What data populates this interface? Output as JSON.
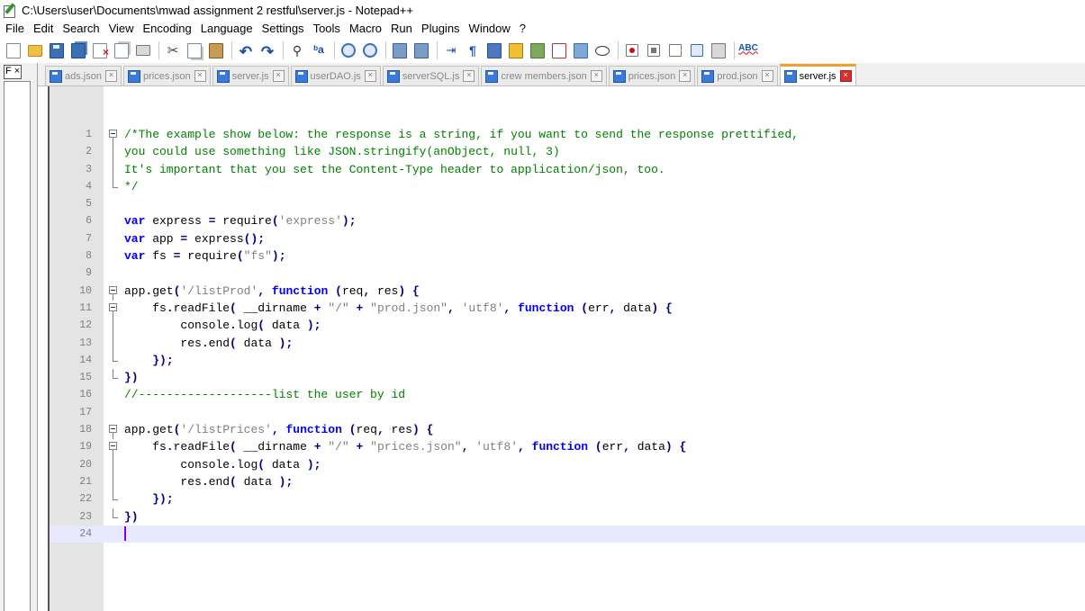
{
  "window": {
    "title": "C:\\Users\\user\\Documents\\mwad assignment 2 restful\\server.js - Notepad++"
  },
  "menu": [
    "File",
    "Edit",
    "Search",
    "View",
    "Encoding",
    "Language",
    "Settings",
    "Tools",
    "Macro",
    "Run",
    "Plugins",
    "Window",
    "?"
  ],
  "toolbar": {
    "groups": [
      [
        "new-file-icon",
        "open-file-icon",
        "save-icon",
        "save-all-icon",
        "close-icon",
        "close-all-icon",
        "print-icon"
      ],
      [
        "cut-icon",
        "copy-icon",
        "paste-icon"
      ],
      [
        "undo-icon",
        "redo-icon"
      ],
      [
        "find-icon",
        "replace-icon"
      ],
      [
        "zoom-in-icon",
        "zoom-out-icon"
      ],
      [
        "sync-vertical-icon",
        "sync-horizontal-icon"
      ],
      [
        "word-wrap-icon",
        "show-all-characters-icon",
        "indent-guide-icon",
        "user-defined-language-icon",
        "document-map-icon",
        "function-list-icon",
        "folder-as-workspace-icon",
        "monitoring-icon"
      ],
      [
        "record-macro-icon",
        "stop-recording-icon",
        "playback-icon",
        "run-macro-multiple-icon",
        "save-macro-icon"
      ],
      [
        "spell-check-icon"
      ]
    ],
    "spell_check_label": "ABC"
  },
  "fpanel": {
    "button_label": "F ×"
  },
  "tabs": [
    {
      "label": "ads.json",
      "active": false
    },
    {
      "label": "prices.json",
      "active": false
    },
    {
      "label": "server.js",
      "active": false
    },
    {
      "label": "userDAO.js",
      "active": false
    },
    {
      "label": "serverSQL.js",
      "active": false
    },
    {
      "label": "crew members.json",
      "active": false
    },
    {
      "label": "prices.json",
      "active": false
    },
    {
      "label": "prod.json",
      "active": false
    },
    {
      "label": "server.js",
      "active": true
    }
  ],
  "tab_close_glyph": "×",
  "editor": {
    "current_line": 24,
    "lines": [
      {
        "n": "1",
        "segs": [
          [
            "cmt",
            "/*The example show below: the response is a string, if you want to send the response prettified,"
          ]
        ]
      },
      {
        "n": "2",
        "segs": [
          [
            "cmt",
            "you could use something like JSON.stringify(anObject, null, 3)"
          ]
        ]
      },
      {
        "n": "3",
        "segs": [
          [
            "cmt",
            "It's important that you set the Content-Type header to application/json, too."
          ]
        ]
      },
      {
        "n": "4",
        "segs": [
          [
            "cmt",
            "*/"
          ]
        ]
      },
      {
        "n": "5",
        "segs": []
      },
      {
        "n": "6",
        "segs": [
          [
            "kw",
            "var"
          ],
          [
            "id",
            " express "
          ],
          [
            "op",
            "="
          ],
          [
            "id",
            " require"
          ],
          [
            "op",
            "("
          ],
          [
            "str",
            "'express'"
          ],
          [
            "op",
            ");"
          ]
        ]
      },
      {
        "n": "7",
        "segs": [
          [
            "kw",
            "var"
          ],
          [
            "id",
            " app "
          ],
          [
            "op",
            "="
          ],
          [
            "id",
            " express"
          ],
          [
            "op",
            "();"
          ]
        ]
      },
      {
        "n": "8",
        "segs": [
          [
            "kw",
            "var"
          ],
          [
            "id",
            " fs "
          ],
          [
            "op",
            "="
          ],
          [
            "id",
            " require"
          ],
          [
            "op",
            "("
          ],
          [
            "str",
            "\"fs\""
          ],
          [
            "op",
            ");"
          ]
        ]
      },
      {
        "n": "9",
        "segs": []
      },
      {
        "n": "10",
        "segs": [
          [
            "id",
            "app"
          ],
          [
            "op",
            "."
          ],
          [
            "id",
            "get"
          ],
          [
            "op",
            "("
          ],
          [
            "str",
            "'/listProd'"
          ],
          [
            "op",
            ","
          ],
          [
            "id",
            " "
          ],
          [
            "kw",
            "function"
          ],
          [
            "id",
            " "
          ],
          [
            "op",
            "("
          ],
          [
            "id",
            "req"
          ],
          [
            "op",
            ","
          ],
          [
            "id",
            " res"
          ],
          [
            "op",
            ")"
          ],
          [
            "id",
            " "
          ],
          [
            "op",
            "{"
          ]
        ]
      },
      {
        "n": "11",
        "segs": [
          [
            "id",
            "    fs"
          ],
          [
            "op",
            "."
          ],
          [
            "id",
            "readFile"
          ],
          [
            "op",
            "("
          ],
          [
            "id",
            " __dirname "
          ],
          [
            "op",
            "+"
          ],
          [
            "id",
            " "
          ],
          [
            "str",
            "\"/\""
          ],
          [
            "id",
            " "
          ],
          [
            "op",
            "+"
          ],
          [
            "id",
            " "
          ],
          [
            "str",
            "\"prod.json\""
          ],
          [
            "op",
            ","
          ],
          [
            "id",
            " "
          ],
          [
            "str",
            "'utf8'"
          ],
          [
            "op",
            ","
          ],
          [
            "id",
            " "
          ],
          [
            "kw",
            "function"
          ],
          [
            "id",
            " "
          ],
          [
            "op",
            "("
          ],
          [
            "id",
            "err"
          ],
          [
            "op",
            ","
          ],
          [
            "id",
            " data"
          ],
          [
            "op",
            ")"
          ],
          [
            "id",
            " "
          ],
          [
            "op",
            "{"
          ]
        ]
      },
      {
        "n": "12",
        "segs": [
          [
            "id",
            "        console"
          ],
          [
            "op",
            "."
          ],
          [
            "id",
            "log"
          ],
          [
            "op",
            "("
          ],
          [
            "id",
            " data "
          ],
          [
            "op",
            ");"
          ]
        ]
      },
      {
        "n": "13",
        "segs": [
          [
            "id",
            "        res"
          ],
          [
            "op",
            "."
          ],
          [
            "id",
            "end"
          ],
          [
            "op",
            "("
          ],
          [
            "id",
            " data "
          ],
          [
            "op",
            ");"
          ]
        ]
      },
      {
        "n": "14",
        "segs": [
          [
            "id",
            "    "
          ],
          [
            "op",
            "});"
          ]
        ]
      },
      {
        "n": "15",
        "segs": [
          [
            "op",
            "})"
          ]
        ]
      },
      {
        "n": "16",
        "segs": [
          [
            "cmt",
            "//-------------------list the user by id"
          ]
        ]
      },
      {
        "n": "17",
        "segs": []
      },
      {
        "n": "18",
        "segs": [
          [
            "id",
            "app"
          ],
          [
            "op",
            "."
          ],
          [
            "id",
            "get"
          ],
          [
            "op",
            "("
          ],
          [
            "str",
            "'/listPrices'"
          ],
          [
            "op",
            ","
          ],
          [
            "id",
            " "
          ],
          [
            "kw",
            "function"
          ],
          [
            "id",
            " "
          ],
          [
            "op",
            "("
          ],
          [
            "id",
            "req"
          ],
          [
            "op",
            ","
          ],
          [
            "id",
            " res"
          ],
          [
            "op",
            ")"
          ],
          [
            "id",
            " "
          ],
          [
            "op",
            "{"
          ]
        ]
      },
      {
        "n": "19",
        "segs": [
          [
            "id",
            "    fs"
          ],
          [
            "op",
            "."
          ],
          [
            "id",
            "readFile"
          ],
          [
            "op",
            "("
          ],
          [
            "id",
            " __dirname "
          ],
          [
            "op",
            "+"
          ],
          [
            "id",
            " "
          ],
          [
            "str",
            "\"/\""
          ],
          [
            "id",
            " "
          ],
          [
            "op",
            "+"
          ],
          [
            "id",
            " "
          ],
          [
            "str",
            "\"prices.json\""
          ],
          [
            "op",
            ","
          ],
          [
            "id",
            " "
          ],
          [
            "str",
            "'utf8'"
          ],
          [
            "op",
            ","
          ],
          [
            "id",
            " "
          ],
          [
            "kw",
            "function"
          ],
          [
            "id",
            " "
          ],
          [
            "op",
            "("
          ],
          [
            "id",
            "err"
          ],
          [
            "op",
            ","
          ],
          [
            "id",
            " data"
          ],
          [
            "op",
            ")"
          ],
          [
            "id",
            " "
          ],
          [
            "op",
            "{"
          ]
        ]
      },
      {
        "n": "20",
        "segs": [
          [
            "id",
            "        console"
          ],
          [
            "op",
            "."
          ],
          [
            "id",
            "log"
          ],
          [
            "op",
            "("
          ],
          [
            "id",
            " data "
          ],
          [
            "op",
            ");"
          ]
        ]
      },
      {
        "n": "21",
        "segs": [
          [
            "id",
            "        res"
          ],
          [
            "op",
            "."
          ],
          [
            "id",
            "end"
          ],
          [
            "op",
            "("
          ],
          [
            "id",
            " data "
          ],
          [
            "op",
            ");"
          ]
        ]
      },
      {
        "n": "22",
        "segs": [
          [
            "id",
            "    "
          ],
          [
            "op",
            "});"
          ]
        ]
      },
      {
        "n": "23",
        "segs": [
          [
            "op",
            "})"
          ]
        ]
      },
      {
        "n": "24",
        "segs": []
      }
    ],
    "folds": {
      "1": "open",
      "2": "mid",
      "3": "mid",
      "4": "end",
      "10": "open",
      "11": "open",
      "12": "mid",
      "13": "mid",
      "14": "end",
      "15": "end",
      "18": "open",
      "19": "open",
      "20": "mid",
      "21": "mid",
      "22": "end",
      "23": "end"
    }
  }
}
